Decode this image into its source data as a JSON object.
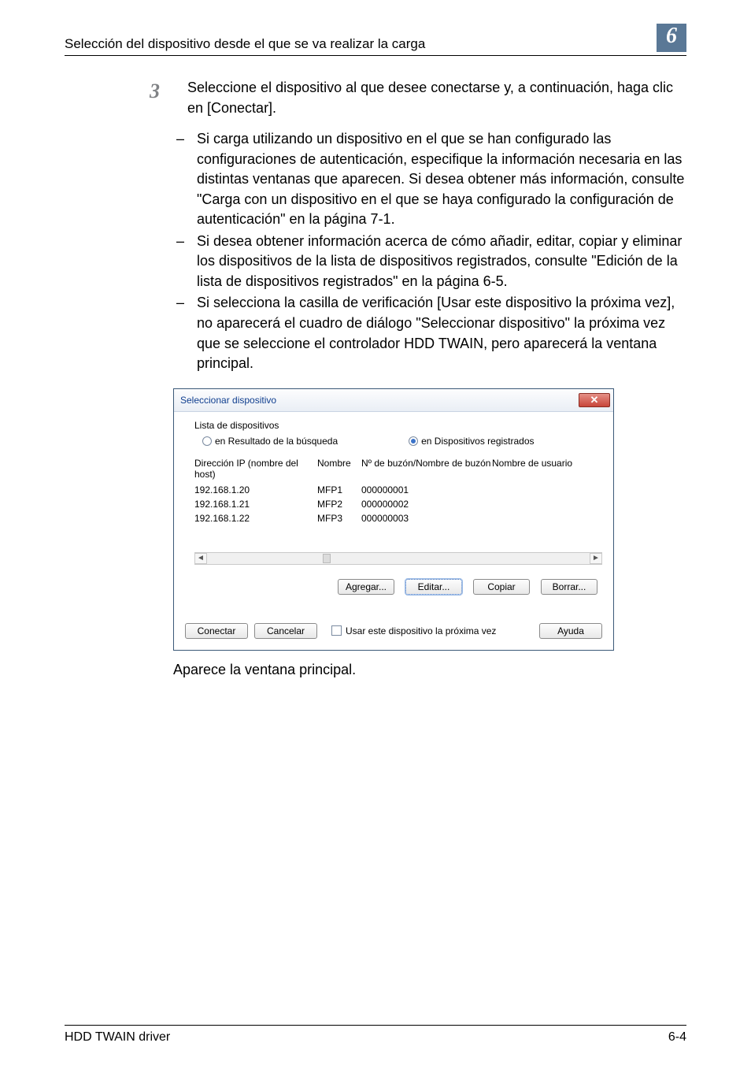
{
  "header": {
    "title": "Selección del dispositivo desde el que se va realizar la carga",
    "chapter": "6"
  },
  "step": {
    "number": "3",
    "text": "Seleccione el dispositivo al que desee conectarse y, a continuación, haga clic en [Conectar]."
  },
  "bullets": [
    "Si carga utilizando un dispositivo en el que se han configurado las configuraciones de autenticación, especifique la información necesaria en las distintas ventanas que aparecen. Si desea obtener más información, consulte \"Carga con un dispositivo en el que se haya configurado la configuración de autenticación\" en la página 7-1.",
    "Si desea obtener información acerca de cómo añadir, editar, copiar y eliminar los dispositivos de la lista de dispositivos registrados, consulte \"Edición de la lista de dispositivos registrados\" en la página 6-5.",
    "Si selecciona la casilla de verificación [Usar este dispositivo la próxima vez], no aparecerá el cuadro de diálogo \"Seleccionar dispositivo\" la próxima vez que se seleccione el controlador HDD TWAIN, pero aparecerá la ventana principal."
  ],
  "dialog": {
    "title": "Seleccionar dispositivo",
    "group_label": "Lista de dispositivos",
    "radio_search": "en Resultado de la búsqueda",
    "radio_registered": "en Dispositivos registrados",
    "columns": {
      "ip": "Dirección IP (nombre del host)",
      "name": "Nombre",
      "box": "Nº de buzón/Nombre de buzón",
      "user": "Nombre de usuario"
    },
    "rows": [
      {
        "ip": "192.168.1.20",
        "name": "MFP1",
        "box": "000000001",
        "user": ""
      },
      {
        "ip": "192.168.1.21",
        "name": "MFP2",
        "box": "000000002",
        "user": ""
      },
      {
        "ip": "192.168.1.22",
        "name": "MFP3",
        "box": "000000003",
        "user": ""
      }
    ],
    "buttons": {
      "add": "Agregar...",
      "edit": "Editar...",
      "copy": "Copiar",
      "delete": "Borrar...",
      "connect": "Conectar",
      "cancel": "Cancelar",
      "help": "Ayuda"
    },
    "use_next_time": "Usar este dispositivo la próxima vez"
  },
  "after_dialog": "Aparece la ventana principal.",
  "footer": {
    "left": "HDD TWAIN driver",
    "right": "6-4"
  }
}
